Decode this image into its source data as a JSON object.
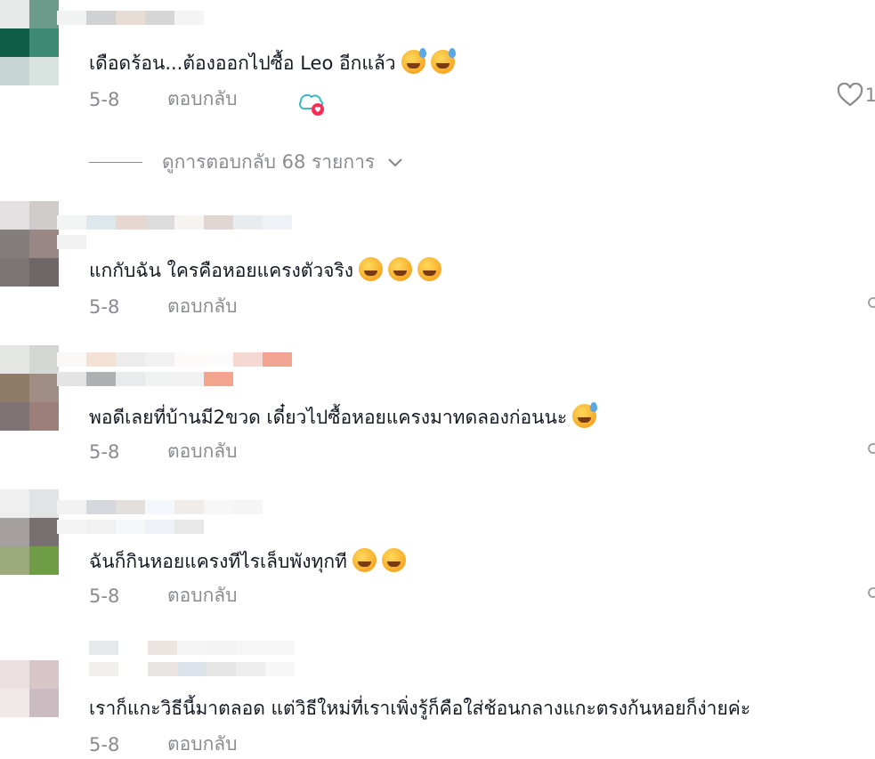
{
  "comments": [
    {
      "text": "เดือดร้อน...ต้องออกไปซื้อ Leo อีกแล้ว",
      "date": "5-8",
      "reply_label": "ตอบกลับ",
      "likes": "1",
      "emojis": [
        "sweat-smile-emoji",
        "sweat-smile-emoji"
      ]
    },
    {
      "text": "แกกับฉัน ใครคือหอยแครงตัวจริง",
      "date": "5-8",
      "reply_label": "ตอบกลับ",
      "emojis": [
        "rofl-emoji",
        "rofl-emoji",
        "rofl-emoji"
      ]
    },
    {
      "text": "พอดีเลยที่บ้านมี2ขวด เดี๋ยวไปซื้อหอยแครงมาทดลองก่อนนะ",
      "date": "5-8",
      "reply_label": "ตอบกลับ",
      "emojis": [
        "sweat-smile-emoji"
      ]
    },
    {
      "text": "ฉันก็กินหอยแครงทีไรเล็บพังทุกที",
      "date": "5-8",
      "reply_label": "ตอบกลับ",
      "emojis": [
        "rofl-emoji",
        "rofl-emoji"
      ]
    },
    {
      "text": "เราก็แกะวิธีนี้มาตลอด แต่วิธีใหม่ที่เราเพิ่งรู้ก็คือใส่ช้อนกลางแกะตรงก้นหอยก็ง่ายค่ะ",
      "date": "5-8",
      "reply_label": "ตอบกลับ",
      "emojis": []
    }
  ],
  "view_replies": {
    "label": "ดูการตอบกลับ 68 รายการ"
  },
  "colors": {
    "text": "#161823",
    "muted": "#8a8b91",
    "creator_badge": "#3fb8c6",
    "heart_badge": "#fe2c55"
  }
}
